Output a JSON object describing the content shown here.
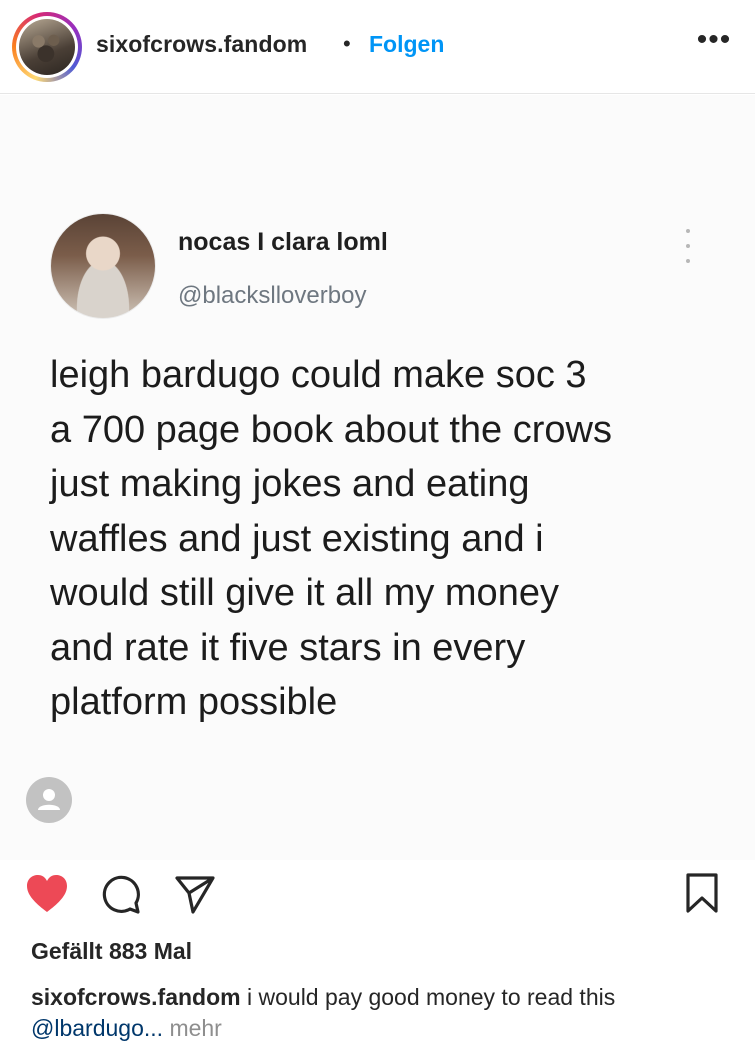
{
  "header": {
    "username": "sixofcrows.fandom",
    "separator": "•",
    "follow_label": "Folgen",
    "more_label": "•••",
    "avatar_icon": "profile-avatar"
  },
  "post": {
    "tweet": {
      "name": "nocas I clara loml",
      "handle": "@blackslloverboy",
      "text": "leigh bardugo could make soc 3\na 700 page book about the crows\njust making jokes and eating\nwaffles and just existing and i\nwould still give it all my money\nand rate it five stars in every\nplatform possible"
    },
    "tag_icon": "person-tag-icon"
  },
  "actions": {
    "like_icon": "heart-icon",
    "comment_icon": "comment-icon",
    "share_icon": "send-icon",
    "save_icon": "bookmark-icon",
    "like_color": "#ed4956"
  },
  "meta": {
    "likes_text": "Gefällt 883 Mal",
    "caption_user": "sixofcrows.fandom",
    "caption_text": " i would pay good money to read this",
    "caption_mention": "@lbardugo",
    "caption_ellipsis": "... ",
    "more_label": "mehr"
  },
  "colors": {
    "link_blue": "#0095f6",
    "text": "#262626",
    "muted": "#8e8e8e"
  }
}
